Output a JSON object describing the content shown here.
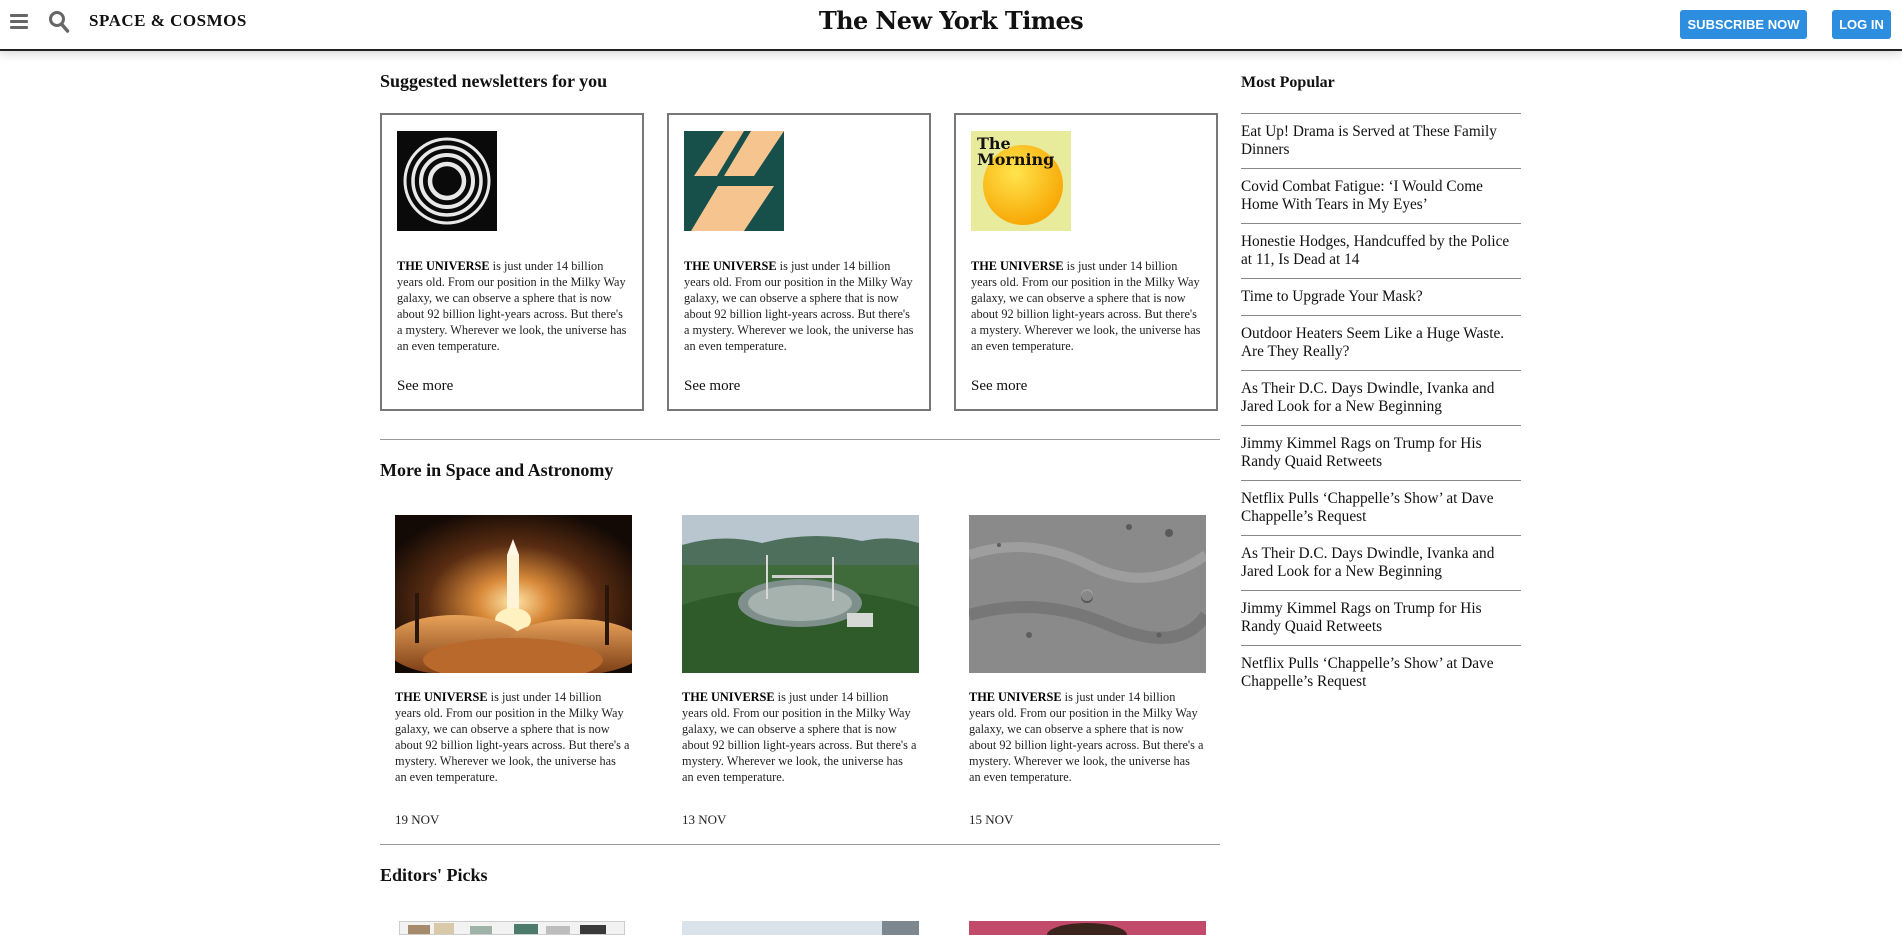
{
  "header": {
    "menu_icon": "hamburger-menu-icon",
    "search_icon": "search-icon",
    "section": "SPACE & COSMOS",
    "logo": "The New York Times",
    "subscribe": "SUBSCRIBE NOW",
    "login": "LOG IN",
    "accent": "#2d8ee0"
  },
  "newsletters": {
    "heading": "Suggested newsletters for you",
    "cards": [
      {
        "lead": "THE UNIVERSE",
        "text": " is just under 14 billion years old. From our position in the Milky Way galaxy, we can observe a sphere that is now about 92 billion light-years across. But there's a mystery. Wherever we look, the universe has an even temperature.",
        "link": "See more"
      },
      {
        "lead": "THE UNIVERSE",
        "text": " is just under 14 billion years old. From our position in the Milky Way galaxy, we can observe a sphere that is now about 92 billion light-years across. But there's a mystery. Wherever we look, the universe has an even temperature.",
        "link": "See more"
      },
      {
        "lead": "THE UNIVERSE",
        "text": " is just under 14 billion years old. From our position in the Milky Way galaxy, we can observe a sphere that is now about 92 billion light-years across. But there's a mystery. Wherever we look, the universe has an even temperature.",
        "link": "See more",
        "logo_line1": "The",
        "logo_line2": "Morning"
      }
    ]
  },
  "more": {
    "heading": "More in Space and Astronomy",
    "articles": [
      {
        "lead": "THE UNIVERSE",
        "text": " is just under 14 billion years old. From our position in the Milky Way galaxy, we can observe a sphere that is now about 92 billion light-years across. But there's a mystery. Wherever we look, the universe has an even temperature.",
        "date": "19 NOV"
      },
      {
        "lead": "THE UNIVERSE",
        "text": " is just under 14 billion years old. From our position in the Milky Way galaxy, we can observe a sphere that is now about 92 billion light-years across. But there's a mystery. Wherever we look, the universe has an even temperature.",
        "date": "13 NOV"
      },
      {
        "lead": "THE UNIVERSE",
        "text": " is just under 14 billion years old. From our position in the Milky Way galaxy, we can observe a sphere that is now about 92 billion light-years across. But there's a mystery. Wherever we look, the universe has an even temperature.",
        "date": "15 NOV"
      }
    ]
  },
  "editors": {
    "heading": "Editors' Picks"
  },
  "most_popular": {
    "heading": "Most Popular",
    "items": [
      "Eat Up! Drama is Served at These Family Dinners",
      "Covid Combat Fatigue: ‘I Would Come Home With Tears in My Eyes’",
      "Honestie Hodges, Handcuffed by the Police at 11, Is Dead at 14",
      "Time to Upgrade Your Mask?",
      "Outdoor Heaters Seem Like a Huge Waste. Are They Really?",
      "As Their D.C. Days Dwindle, Ivanka and Jared Look for a New Beginning",
      "Jimmy Kimmel Rags on Trump for His Randy Quaid Retweets",
      "Netflix Pulls ‘Chappelle’s Show’ at Dave Chappelle’s Request",
      "As Their D.C. Days Dwindle, Ivanka and Jared Look for a New Beginning",
      "Jimmy Kimmel Rags on Trump for His Randy Quaid Retweets",
      "Netflix Pulls ‘Chappelle’s Show’ at Dave Chappelle’s Request"
    ]
  }
}
